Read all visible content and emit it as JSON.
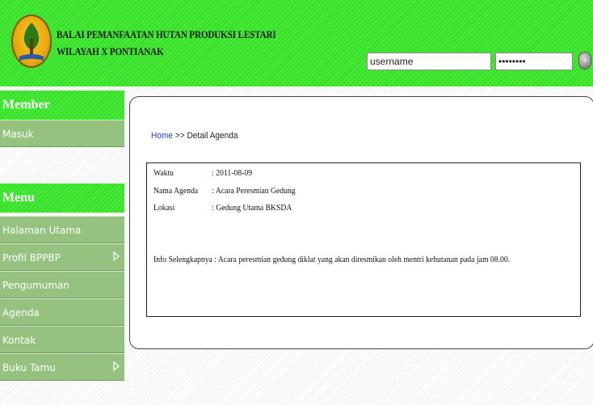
{
  "header": {
    "org_line1": "BALAI PEMANFAATAN HUTAN PRODUKSI LESTARI",
    "org_line2": "WILAYAH X PONTIANAK",
    "username_value": "username",
    "password_value": "••••••••"
  },
  "sidebar": {
    "member_title": "Member",
    "member_items": [
      {
        "label": "Masuk"
      }
    ],
    "menu_title": "Menu",
    "menu_items": [
      {
        "label": "Halaman Utama"
      },
      {
        "label": "Profil BPPBP"
      },
      {
        "label": "Pengumuman"
      },
      {
        "label": "Agenda"
      },
      {
        "label": "Kontak"
      },
      {
        "label": "Buku Tamu"
      }
    ]
  },
  "breadcrumb": {
    "home": "Home",
    "rest": " >> Detail Agenda"
  },
  "detail": {
    "waktu_label": "Waktu",
    "waktu_value": ": 2011-08-09",
    "nama_label": "Nama Agenda",
    "nama_value": ": Acara Peresmian Gedung",
    "lokasi_label": "Lokasi",
    "lokasi_value": ": Gedung Utama BKSDA",
    "info_label": "Info Selengkapnya",
    "info_value": " : Acara peresmian gedung diklat yang akan diresmikan oleh mentri kehutanan pada jam 08.00."
  }
}
